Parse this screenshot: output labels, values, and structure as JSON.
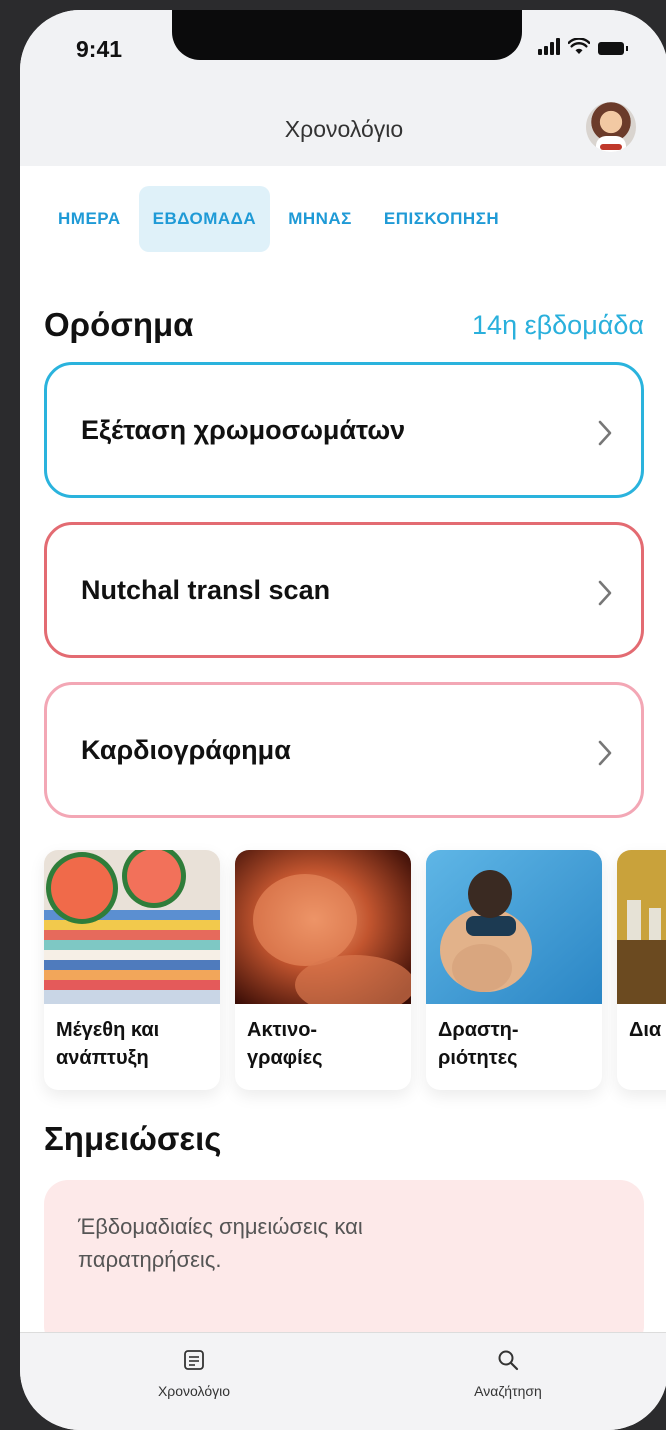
{
  "status_bar": {
    "time": "9:41"
  },
  "header": {
    "title": "Χρονολόγιο"
  },
  "tabs": [
    {
      "label": "ΗΜΕΡΑ",
      "active": false
    },
    {
      "label": "ΕΒΔΟΜΑΔΑ",
      "active": true
    },
    {
      "label": "ΜΗΝΑΣ",
      "active": false
    },
    {
      "label": "ΕΠΙΣΚΟΠΗΣΗ",
      "active": false
    }
  ],
  "milestones": {
    "title": "Ορόσημα",
    "week": "14η εβδομάδα",
    "items": [
      {
        "label": "Εξέταση χρωμοσωμάτων",
        "border_color": "#2ab3dd"
      },
      {
        "label": "Nutchal transl scan",
        "border_color": "#e36b72"
      },
      {
        "label": "Καρδιογράφημα",
        "border_color": "#f3a7b5"
      }
    ]
  },
  "cards": [
    {
      "label": "Μέγεθη και\nανάπτυξη"
    },
    {
      "label": "Ακτινο-\nγραφίες"
    },
    {
      "label": "Δραστη-\nριότητες"
    },
    {
      "label": "Δια"
    }
  ],
  "notes": {
    "title": "Σημειώσεις",
    "placeholder": "Έβδομαδιαίες σημειώσεις και παρατηρήσεις."
  },
  "tabbar": {
    "items": [
      {
        "label": "Χρονολόγιο",
        "icon": "timeline-icon"
      },
      {
        "label": "Αναζήτηση",
        "icon": "search-icon"
      }
    ]
  },
  "colors": {
    "accent": "#2ab0dc",
    "tab_text": "#1f9ad6",
    "tab_active_bg": "#dff1f9",
    "notes_bg": "#fde9e9"
  }
}
